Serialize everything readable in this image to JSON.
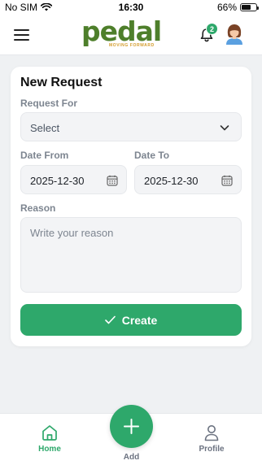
{
  "status_bar": {
    "carrier": "No SIM",
    "time": "16:30",
    "battery_text": "66%",
    "battery_level": 0.66
  },
  "header": {
    "logo_text": "pedal",
    "logo_tagline": "MOVING FORWARD",
    "notification_count": "2",
    "icons": {
      "menu": "hamburger-menu-icon",
      "bell": "bell-icon",
      "avatar": "user-avatar"
    }
  },
  "form": {
    "title": "New Request",
    "request_for": {
      "label": "Request For",
      "value": "Select"
    },
    "date_from": {
      "label": "Date From",
      "value": "2025-12-30"
    },
    "date_to": {
      "label": "Date To",
      "value": "2025-12-30"
    },
    "reason": {
      "label": "Reason",
      "placeholder": "Write your reason",
      "value": ""
    },
    "create_label": "Create"
  },
  "bottom_nav": {
    "home": "Home",
    "add": "Add",
    "profile": "Profile",
    "active": "Home"
  },
  "colors": {
    "accent": "#2ea86b",
    "logo_green": "#4e7f2b",
    "logo_gold": "#d39b2a",
    "background": "#eff1f3"
  }
}
